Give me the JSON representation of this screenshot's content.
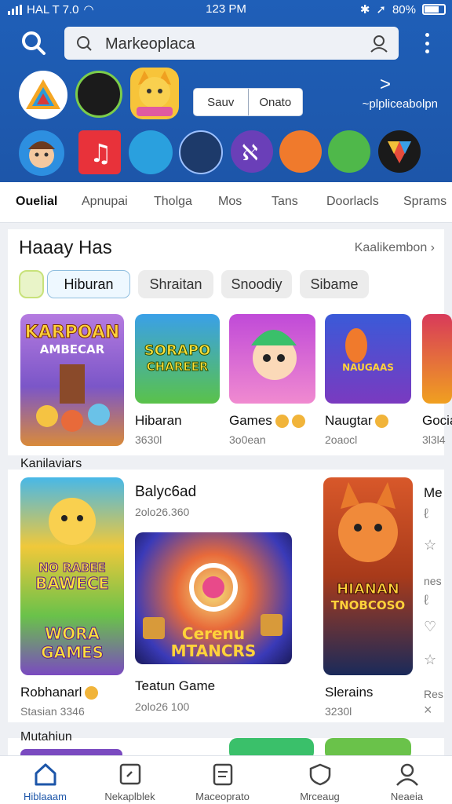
{
  "status_bar": {
    "carrier": "HAL T 7.0",
    "time": "123 PM",
    "battery": "80%"
  },
  "search": {
    "placeholder": "Markeoplaca"
  },
  "segment": {
    "left": "Sauv",
    "right": "Onato"
  },
  "app_link": {
    "label": "~plpliceabolpn"
  },
  "tabs": [
    "Ouelial",
    "Apnupai",
    "Tholga",
    "Mos",
    "Tans",
    "Doorlacls",
    "Sprams"
  ],
  "section1": {
    "title": "Haaay Has",
    "link": "Kaalikembon"
  },
  "chips": [
    "Hiburan",
    "Shraitan",
    "Snoodiy",
    "Sibame"
  ],
  "games_row1": [
    {
      "name": "Hibaran",
      "meta": "3630l"
    },
    {
      "name": "Games",
      "meta": "3o0ean"
    },
    {
      "name": "Naugtar",
      "meta": "2oaocl"
    },
    {
      "name": "Gocia",
      "meta": "3l3l4"
    }
  ],
  "thumb_text": {
    "t1": "KARPOAN",
    "t1b": "AMBECAR",
    "t2": "SORAPO",
    "t2b": "CHAREER",
    "t4": "NAUGAAS"
  },
  "section2": {
    "title": "Kanilaviars"
  },
  "featured": [
    {
      "name": "Robhanarl",
      "meta": "Stasian 3346"
    },
    {
      "name": "Teatun Game",
      "meta": "2olo26 100"
    },
    {
      "name": "Slerains",
      "meta": "3230l"
    }
  ],
  "featured_top": {
    "name": "Balyc6ad",
    "meta": "2olo26.360"
  },
  "featured_thumb": {
    "f1a": "NO RABEE",
    "f1b": "BAWECE",
    "f1c": "WORA",
    "f1d": "GAMES",
    "f2a": "Cerenu",
    "f2b": "MTANCRS",
    "f3a": "HIANAN",
    "f3b": "TNOBCOSO"
  },
  "side_list": [
    "Me",
    "nes",
    "Res"
  ],
  "section3": {
    "title": "Mutahiun"
  },
  "bottom_nav": [
    "Hiblaaam",
    "Nekaplblek",
    "Maceoprato",
    "Mrceaug",
    "Neaeia"
  ],
  "colors": {
    "header": "#1d56a9",
    "accent": "#1d56a9",
    "badge": "#f1b43a"
  }
}
